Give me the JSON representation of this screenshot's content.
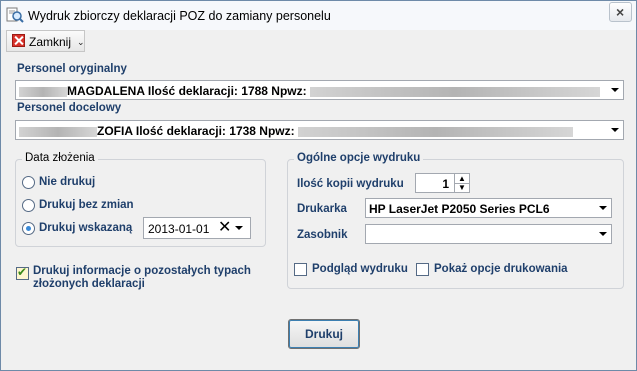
{
  "window": {
    "title": "Wydruk zbiorczy deklaracji POZ do zamiany personelu"
  },
  "toolbar": {
    "close_label": "Zamknij"
  },
  "personel_oryginalny": {
    "label": "Personel oryginalny",
    "value": "MAGDALENA  Ilość deklaracji: 1788  Npwz:"
  },
  "personel_docelowy": {
    "label": "Personel docelowy",
    "value": "ZOFIA  Ilość deklaracji: 1738  Npwz:"
  },
  "data_zlozenia": {
    "group_title": "Data złożenia",
    "options": [
      "Nie drukuj",
      "Drukuj bez zmian",
      "Drukuj wskazaną"
    ],
    "selected": "Drukuj wskazaną",
    "date": "2013-01-01"
  },
  "info_checkbox": {
    "label_line1": "Drukuj informacje o pozostałych typach",
    "label_line2": "złożonych deklaracji",
    "checked": true
  },
  "opcje_wydruku": {
    "group_title": "Ogólne opcje wydruku",
    "copies_label": "Ilość kopii wydruku",
    "copies_value": "1",
    "printer_label": "Drukarka",
    "printer_value": "HP LaserJet P2050 Series PCL6",
    "tray_label": "Zasobnik",
    "tray_value": "",
    "preview_label": "Podgląd wydruku",
    "show_options_label": "Pokaż opcje drukowania"
  },
  "actions": {
    "print_label": "Drukuj"
  },
  "colors": {
    "label_blue": "#1f3f6b",
    "accent": "#3a8ad8",
    "close_red": "#d8322a"
  }
}
